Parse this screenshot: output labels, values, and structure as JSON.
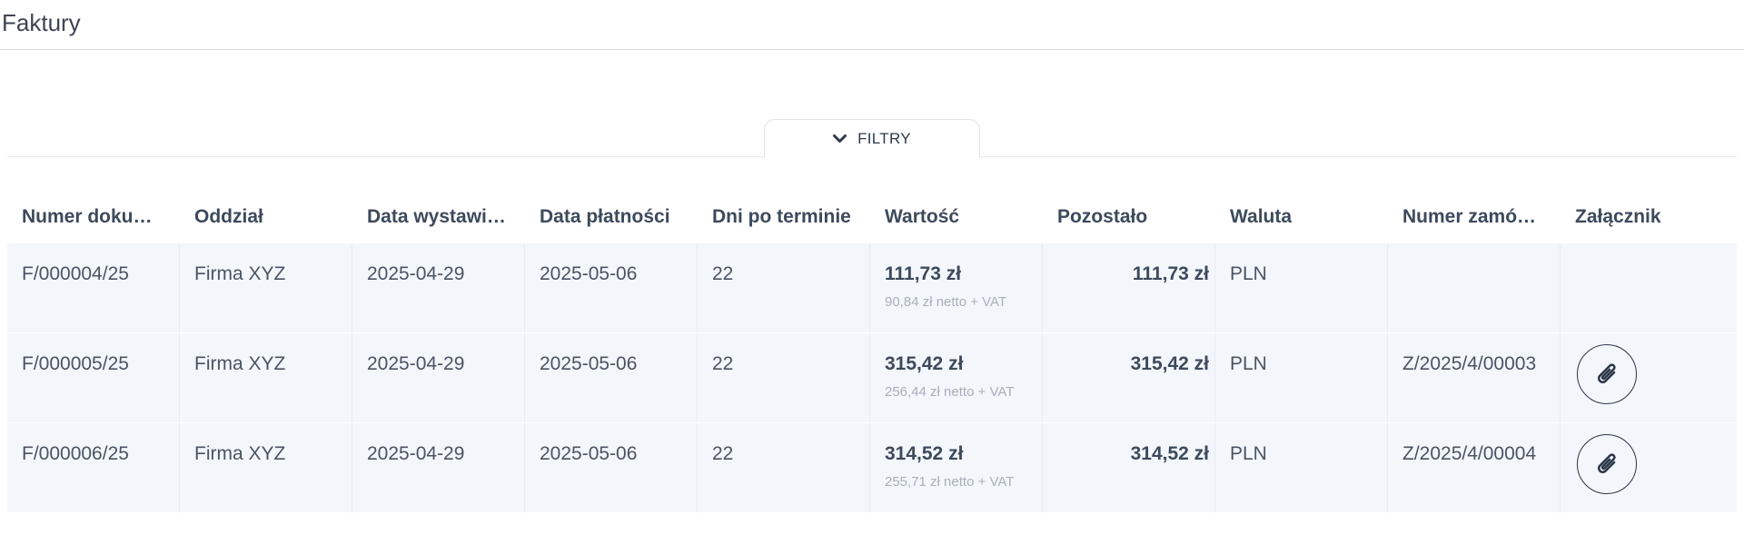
{
  "page": {
    "title": "Faktury"
  },
  "filters": {
    "label": "FILTRY"
  },
  "table": {
    "headers": [
      "Numer dokum…",
      "Oddział",
      "Data wystawi…",
      "Data płatności",
      "Dni po terminie",
      "Wartość",
      "Pozostało",
      "Waluta",
      "Numer zamó…",
      "Załącznik"
    ],
    "rows": [
      {
        "number": "F/000004/25",
        "branch": "Firma XYZ",
        "issue_date": "2025-04-29",
        "payment_date": "2025-05-06",
        "days_overdue": "22",
        "value": "111,73 zł",
        "value_net": "90,84 zł netto + VAT",
        "remaining": "111,73 zł",
        "currency": "PLN",
        "order_number": "",
        "has_attachment": false
      },
      {
        "number": "F/000005/25",
        "branch": "Firma XYZ",
        "issue_date": "2025-04-29",
        "payment_date": "2025-05-06",
        "days_overdue": "22",
        "value": "315,42 zł",
        "value_net": "256,44 zł netto + VAT",
        "remaining": "315,42 zł",
        "currency": "PLN",
        "order_number": "Z/2025/4/00003",
        "has_attachment": true
      },
      {
        "number": "F/000006/25",
        "branch": "Firma XYZ",
        "issue_date": "2025-04-29",
        "payment_date": "2025-05-06",
        "days_overdue": "22",
        "value": "314,52 zł",
        "value_net": "255,71 zł netto + VAT",
        "remaining": "314,52 zł",
        "currency": "PLN",
        "order_number": "Z/2025/4/00004",
        "has_attachment": true
      }
    ]
  },
  "icons": {
    "filter_toggle": "chevron-down-icon",
    "attachment": "paperclip-icon"
  },
  "colors": {
    "row_bg": "#f3f6fb",
    "text": "#3d4a5c",
    "muted": "#a9b0bb"
  }
}
